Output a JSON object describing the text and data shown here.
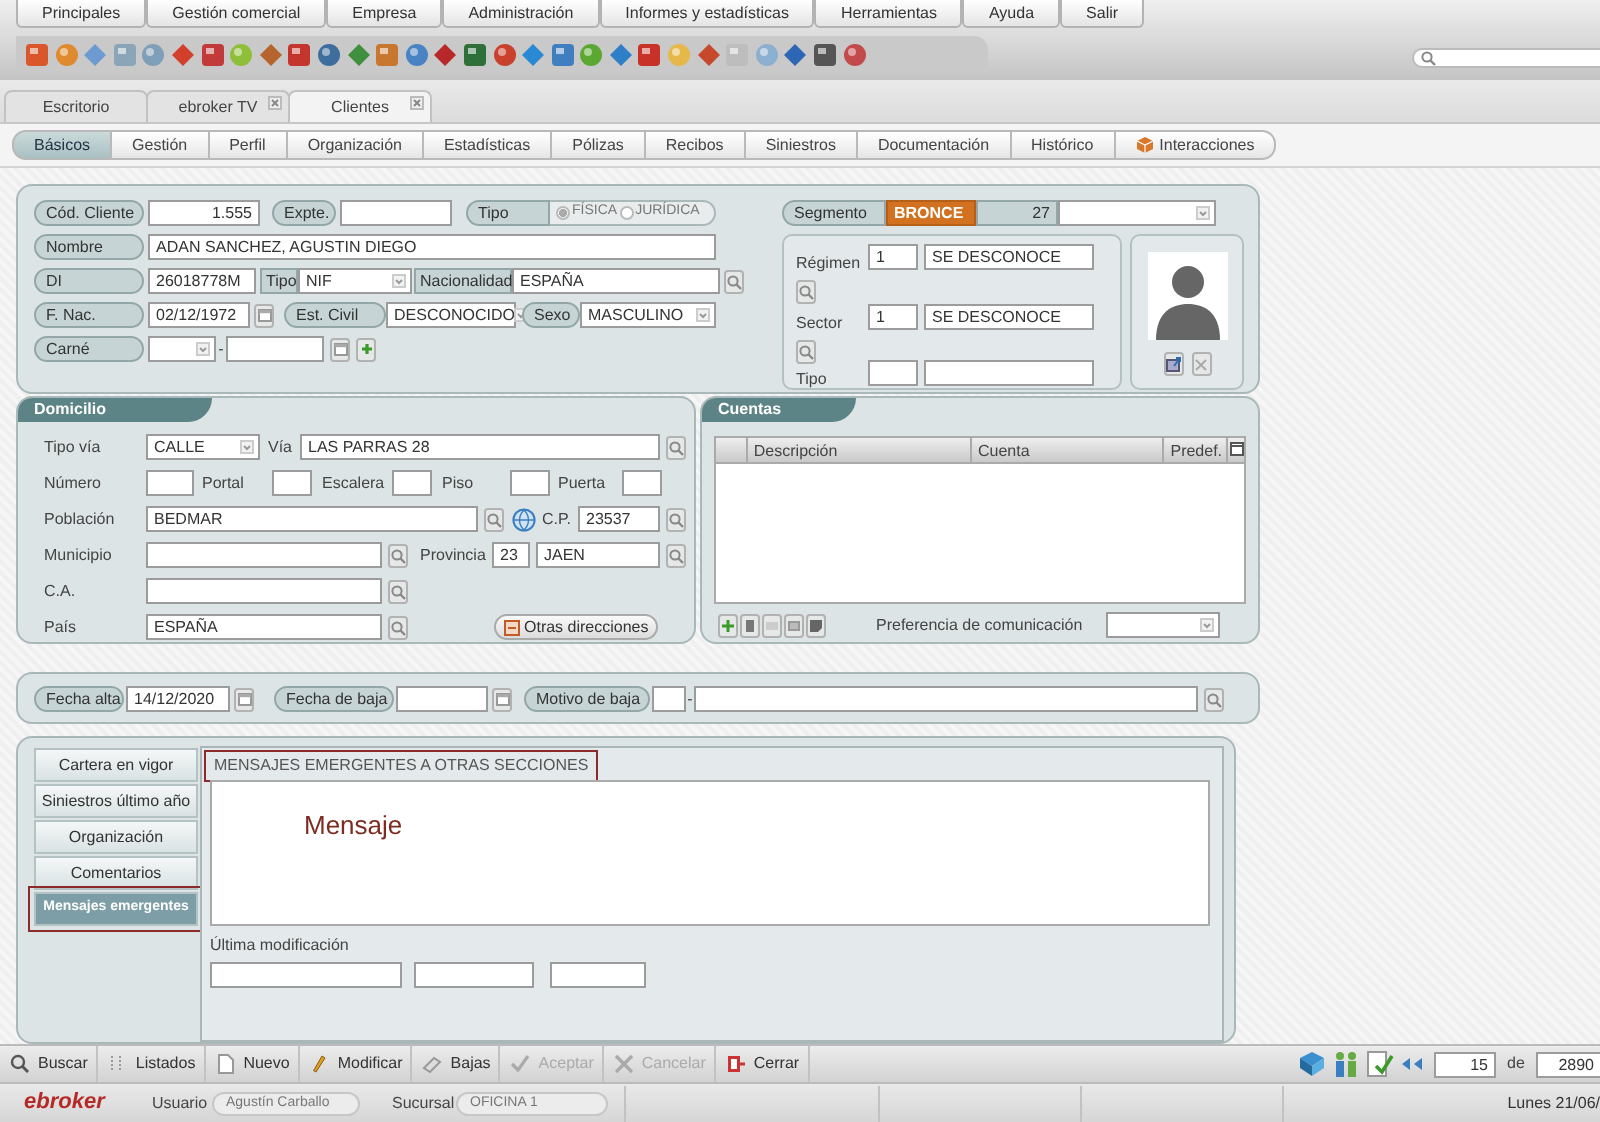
{
  "menu": [
    "Principales",
    "Gestión comercial",
    "Empresa",
    "Administración",
    "Informes y estadísticas",
    "Herramientas",
    "Ayuda",
    "Salir"
  ],
  "doc_tabs": [
    {
      "label": "Escritorio",
      "selected": false,
      "closable": false
    },
    {
      "label": "ebroker TV",
      "selected": false,
      "closable": true
    },
    {
      "label": "Clientes",
      "selected": true,
      "closable": true
    }
  ],
  "section_tabs": [
    {
      "label": "Básicos",
      "selected": true,
      "kind": "plain"
    },
    {
      "label": "Gestión",
      "selected": false,
      "kind": "plain"
    },
    {
      "label": "Perfil",
      "selected": false,
      "kind": "plain"
    },
    {
      "label": "Organización",
      "selected": false,
      "kind": "plain"
    },
    {
      "label": "Estadísticas",
      "selected": false,
      "kind": "plain"
    },
    {
      "label": "Pólizas",
      "selected": false,
      "kind": "plain"
    },
    {
      "label": "Recibos",
      "selected": false,
      "kind": "plain"
    },
    {
      "label": "Siniestros",
      "selected": false,
      "kind": "plain"
    },
    {
      "label": "Documentación",
      "selected": false,
      "kind": "plain"
    },
    {
      "label": "Histórico",
      "selected": false,
      "kind": "plain"
    },
    {
      "label": "Interacciones",
      "selected": false,
      "kind": "icon"
    }
  ],
  "client": {
    "code": {
      "label": "Cód. Cliente",
      "value": "1.555"
    },
    "file": {
      "label": "Expte."
    },
    "type": {
      "label": "Tipo",
      "options": [
        {
          "label": "FÍSICA",
          "selected": true
        },
        {
          "label": "JURÍDICA",
          "selected": false
        }
      ]
    },
    "name": {
      "label": "Nombre",
      "value": "ADAN SANCHEZ, AGUSTIN DIEGO"
    },
    "id": {
      "label": "DI",
      "value": "26018778M"
    },
    "id_type": {
      "label": "Tipo",
      "value": "NIF"
    },
    "nationality": {
      "label": "Nacionalidad",
      "value": "ESPAÑA"
    },
    "birth_date": {
      "label": "F. Nac.",
      "value": "02/12/1972"
    },
    "civil_status": {
      "label": "Est. Civil",
      "value": "DESCONOCIDO"
    },
    "sex": {
      "label": "Sexo",
      "value": "MASCULINO"
    },
    "license": {
      "label": "Carné",
      "separator": "-"
    },
    "segment": {
      "label": "Segmento",
      "value": "BRONCE",
      "score": "27"
    },
    "classification": [
      {
        "label": "Régimen",
        "code": "1",
        "value": "SE DESCONOCE"
      },
      {
        "label": "Sector",
        "code": "1",
        "value": "SE DESCONOCE"
      },
      {
        "label": "Tipo"
      }
    ]
  },
  "address": {
    "title": "Domicilio",
    "street_type": {
      "label": "Tipo vía",
      "value": "CALLE"
    },
    "street": {
      "label": "Vía",
      "value": "LAS PARRAS 28"
    },
    "number": {
      "label": "Número"
    },
    "portal": {
      "label": "Portal"
    },
    "stair": {
      "label": "Escalera"
    },
    "floor": {
      "label": "Piso"
    },
    "door": {
      "label": "Puerta"
    },
    "town": {
      "label": "Población",
      "value": "BEDMAR"
    },
    "postcode": {
      "label": "C.P.",
      "value": "23537"
    },
    "municipality": {
      "label": "Municipio"
    },
    "province": {
      "label": "Provincia",
      "code": "23",
      "value": "JAEN"
    },
    "region": {
      "label": "C.A."
    },
    "country": {
      "label": "País",
      "value": "ESPAÑA"
    },
    "other_button": "Otras direcciones"
  },
  "accounts": {
    "title": "Cuentas",
    "columns": [
      "Descripción",
      "Cuenta",
      "Predef."
    ],
    "preference_label": "Preferencia de comunicación"
  },
  "dates": {
    "start": {
      "label": "Fecha alta",
      "value": "14/12/2020"
    },
    "end": {
      "label": "Fecha de baja"
    },
    "reason": {
      "label": "Motivo de baja",
      "separator": "-"
    }
  },
  "detail": {
    "tabs": [
      {
        "label": "Cartera en vigor",
        "selected": false,
        "highlighted": false
      },
      {
        "label": "Siniestros último año",
        "selected": false,
        "highlighted": false
      },
      {
        "label": "Organización",
        "selected": false,
        "highlighted": false
      },
      {
        "label": "Comentarios",
        "selected": false,
        "highlighted": false
      },
      {
        "label": "Mensajes emergentes",
        "selected": true,
        "highlighted": true
      }
    ],
    "section": {
      "title": "MENSAJES EMERGENTES A OTRAS SECCIONES",
      "highlighted": true
    },
    "message": "Mensaje",
    "modified_label": "Última modificación"
  },
  "actions": [
    {
      "label": "Buscar",
      "kind": "search",
      "disabled": false
    },
    {
      "label": "Listados",
      "kind": "list",
      "disabled": false
    },
    {
      "label": "Nuevo",
      "kind": "new",
      "disabled": false
    },
    {
      "label": "Modificar",
      "kind": "edit",
      "disabled": false
    },
    {
      "label": "Bajas",
      "kind": "erase",
      "disabled": false
    },
    {
      "label": "Aceptar",
      "kind": "accept",
      "disabled": true
    },
    {
      "label": "Cancelar",
      "kind": "cancel",
      "disabled": true
    },
    {
      "label": "Cerrar",
      "kind": "close",
      "disabled": false
    }
  ],
  "pager": {
    "current": "15",
    "of_label": "de",
    "total": "2890"
  },
  "status": {
    "logo": "ebroker",
    "user_label": "Usuario",
    "user": "Agustín Carballo",
    "branch_label": "Sucursal",
    "branch": "OFICINA 1",
    "date": "Lunes 21/06/"
  }
}
